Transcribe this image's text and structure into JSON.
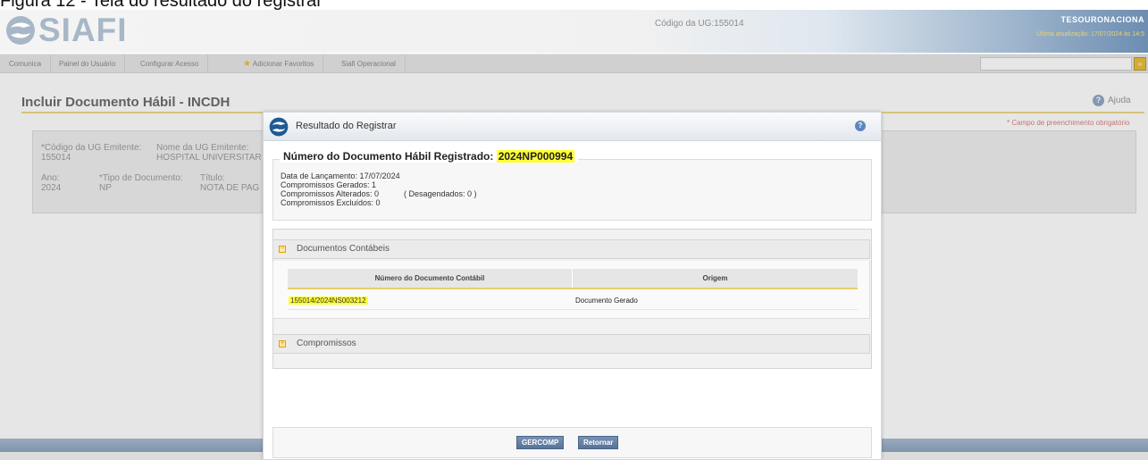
{
  "caption": "Figura 12 - Tela do resultado do registrar",
  "header": {
    "logo": "SIAFI",
    "ug_code": "Código da UG:155014",
    "tesouro": "TESOURONACIONA",
    "last_update": "Última atualização: 17/07/2024 às 14:5"
  },
  "menu": {
    "items": [
      "Comunica",
      "Painel do Usuário",
      "Configurar Acesso",
      "Adicionar Favoritos",
      "Siafi Operacional"
    ],
    "go_label": "»"
  },
  "page": {
    "title": "Incluir Documento Hábil - INCDH",
    "help": "Ajuda",
    "required_note": "* Campo de preenchimento obrigatório"
  },
  "form": {
    "cod_ug_label": "*Código da UG Emitente:",
    "cod_ug_value": "155014",
    "nome_ug_label": "Nome da UG Emitente:",
    "nome_ug_value": "HOSPITAL UNIVERSITAR",
    "ano_label": "Ano:",
    "ano_value": "2024",
    "tipo_label": "*Tipo de Documento:",
    "tipo_value": "NP",
    "titulo_label": "Título:",
    "titulo_value": "NOTA DE PAG"
  },
  "modal": {
    "title": "Resultado do Registrar",
    "legend_label": "Número do Documento Hábil Registrado:",
    "legend_value": "2024NP000994",
    "data_lancamento": "Data de Lançamento:  17/07/2024",
    "comp_gerados": "Compromissos Gerados:  1",
    "comp_alterados": "Compromissos Alterados:  0",
    "desagendados": "( Desagendados: 0 )",
    "comp_excluidos": "Compromissos Excluídos:  0",
    "sec_docs": "Documentos Contábeis",
    "sec_comp": "Compromissos",
    "col_numero": "Número do Documento Contábil",
    "col_origem": "Origem",
    "rows": [
      {
        "numero": "155014/2024NS003212",
        "origem": "Documento Gerado"
      }
    ],
    "btn_gercomp": "GERCOMP",
    "btn_retornar": "Retornar"
  }
}
